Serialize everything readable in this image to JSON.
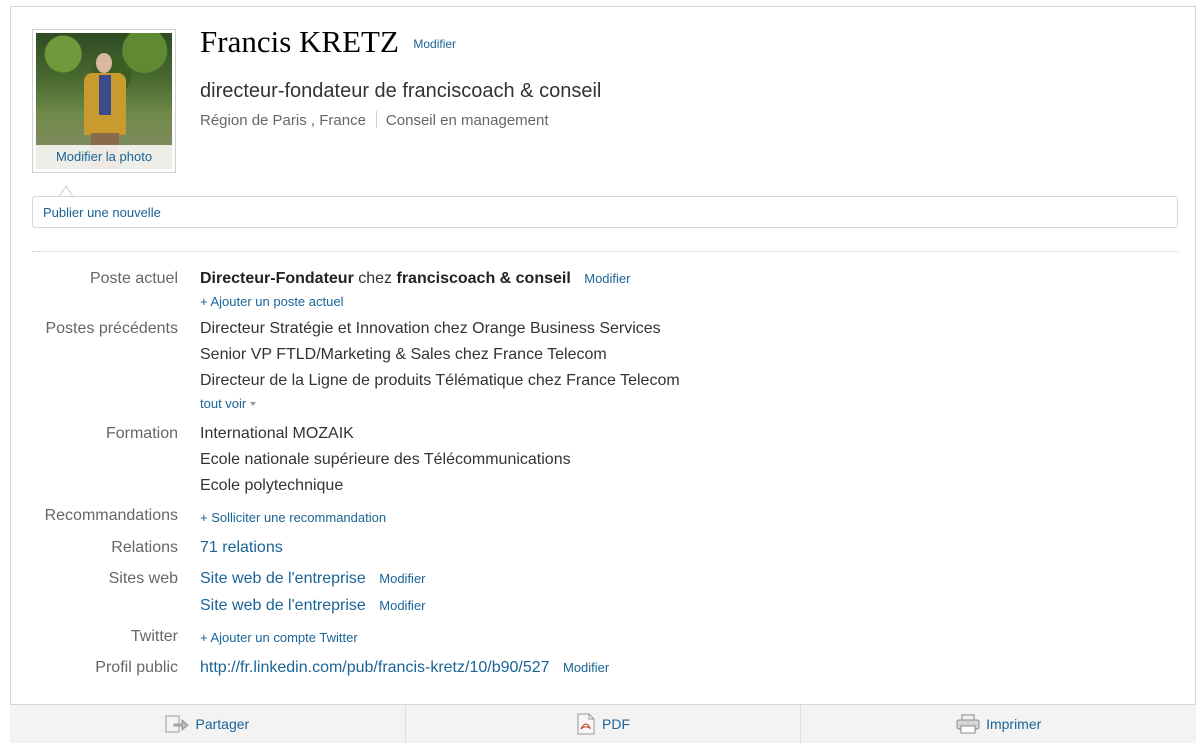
{
  "profile": {
    "name": "Francis KRETZ",
    "edit_label": "Modifier",
    "headline": "directeur-fondateur de franciscoach & conseil",
    "location": "Région de Paris , France",
    "industry": "Conseil en management",
    "photo_caption": "Modifier la photo"
  },
  "publish": {
    "label": "Publier une nouvelle"
  },
  "rows": {
    "current": {
      "label": "Poste actuel",
      "title": "Directeur-Fondateur",
      "connector": "chez",
      "company": "franciscoach & conseil",
      "edit": "Modifier",
      "add": "+ Ajouter un poste actuel"
    },
    "previous": {
      "label": "Postes précédents",
      "items": [
        "Directeur Stratégie et Innovation chez Orange Business Services",
        "Senior VP FTLD/Marketing & Sales chez France Telecom",
        "Directeur de la Ligne de produits Télématique chez France Telecom"
      ],
      "see_all": "tout voir"
    },
    "education": {
      "label": "Formation",
      "items": [
        "International MOZAIK",
        "Ecole nationale supérieure des Télécommunications",
        "Ecole polytechnique"
      ]
    },
    "recommendations": {
      "label": "Recommandations",
      "add": "+ Solliciter une recommandation"
    },
    "connections": {
      "label": "Relations",
      "value": "71 relations"
    },
    "websites": {
      "label": "Sites web",
      "items": [
        {
          "text": "Site web de l'entreprise",
          "edit": "Modifier"
        },
        {
          "text": "Site web de l'entreprise",
          "edit": "Modifier"
        }
      ]
    },
    "twitter": {
      "label": "Twitter",
      "add": "+ Ajouter un compte Twitter"
    },
    "public_profile": {
      "label": "Profil public",
      "url": "http://fr.linkedin.com/pub/francis-kretz/10/b90/527",
      "edit": "Modifier"
    }
  },
  "footer": {
    "share": {
      "label": "Partager",
      "icon": "share-icon"
    },
    "pdf": {
      "label": "PDF",
      "icon": "pdf-icon"
    },
    "print": {
      "label": "Imprimer",
      "icon": "printer-icon"
    }
  },
  "colors": {
    "link": "#1a6496",
    "label": "#666666",
    "text": "#333333"
  }
}
